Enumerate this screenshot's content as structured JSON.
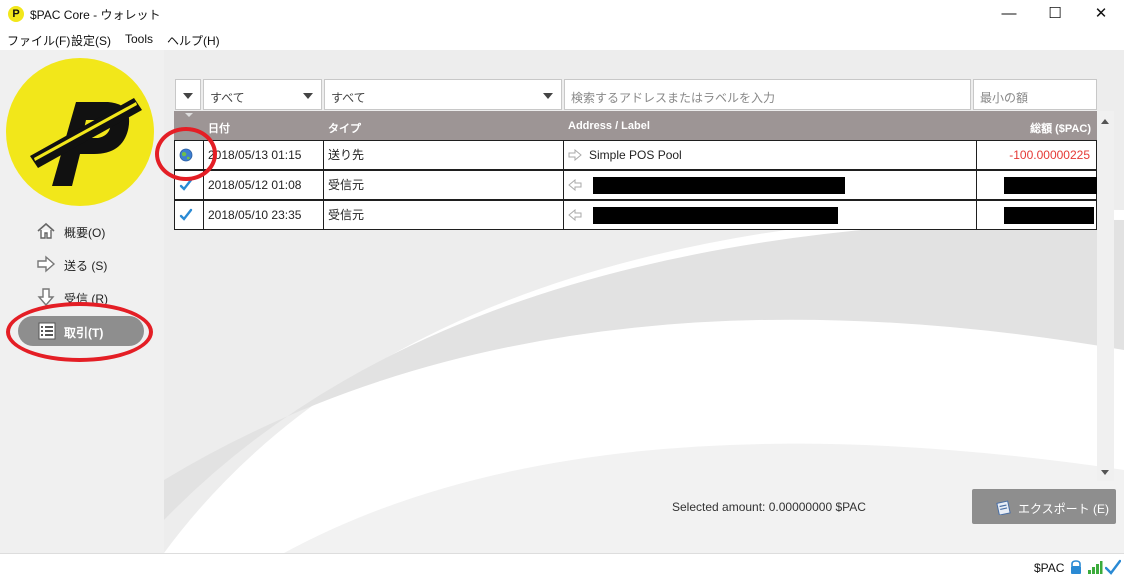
{
  "window": {
    "title": "$PAC Core - ウォレット",
    "app_icon_glyph": "P",
    "minimize_glyph": "—",
    "maximize_glyph": "☐",
    "close_glyph": "✕"
  },
  "menu": [
    {
      "label": "ファイル(F)"
    },
    {
      "label": "設定(S)"
    },
    {
      "label": "Tools"
    },
    {
      "label": "ヘルプ(H)"
    }
  ],
  "sidebar": {
    "items": [
      {
        "label": "概要(O)",
        "icon": "home-icon"
      },
      {
        "label": "送る (S)",
        "icon": "send-arrow-icon"
      },
      {
        "label": "受信 (R)",
        "icon": "receive-arrow-icon"
      },
      {
        "label": "取引(T)",
        "icon": "list-icon",
        "active": true
      }
    ]
  },
  "filters": {
    "date": "すべて",
    "type": "すべて",
    "search_placeholder": "検索するアドレスまたはラベルを入力",
    "min_amount_placeholder": "最小の額"
  },
  "table": {
    "columns": {
      "date": "日付",
      "type": "タイプ",
      "address": "Address / Label",
      "amount": "総額 ($PAC)"
    },
    "rows": [
      {
        "status": "unconfirmed-globe-icon",
        "date": "2018/05/13 01:15",
        "type": "送り先",
        "address_icon": "outgoing-arrow-icon",
        "address": "Simple POS Pool",
        "amount": "-100.00000225",
        "redacted": false
      },
      {
        "status": "confirmed-check-icon",
        "date": "2018/05/12 01:08",
        "type": "受信元",
        "address_icon": "incoming-arrow-icon",
        "address": "",
        "amount": "",
        "redacted": true
      },
      {
        "status": "confirmed-check-icon",
        "date": "2018/05/10 23:35",
        "type": "受信元",
        "address_icon": "incoming-arrow-icon",
        "address": "",
        "amount": "",
        "redacted": true
      }
    ]
  },
  "footer": {
    "selected_amount": "Selected amount:  0.00000000 $PAC",
    "export_label": "エクスポート (E)"
  },
  "statusbar": {
    "unit": "$PAC"
  },
  "colors": {
    "brand_yellow": "#f2e71a",
    "header_gray": "#9d9595",
    "active_nav": "#8e8e8e",
    "negative_amount": "#e53935",
    "annotation_red": "#e41e25",
    "check_blue": "#2a8ad4"
  }
}
